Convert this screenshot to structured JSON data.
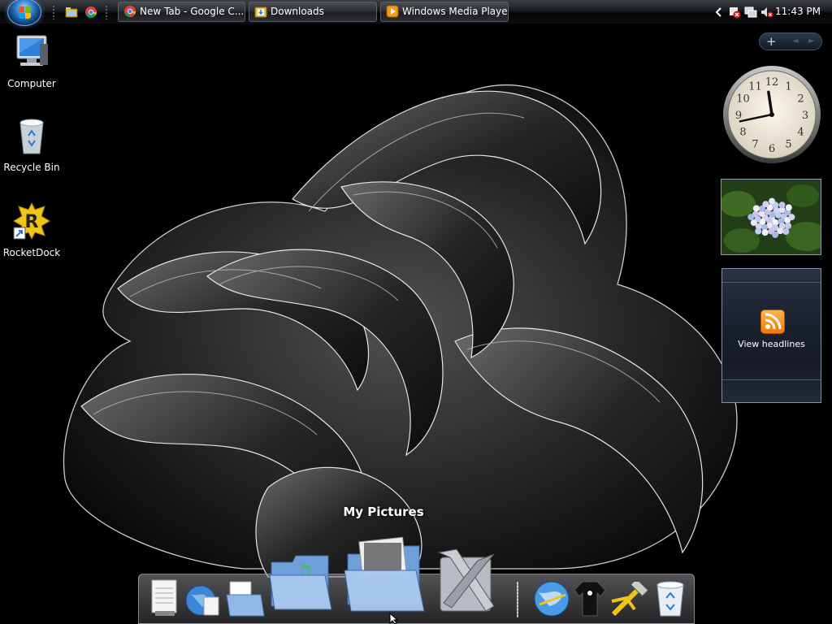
{
  "taskbar": {
    "start_button": "start-orb",
    "quick_launch": [
      "explorer-folder-icon",
      "chrome-icon"
    ],
    "windows": [
      {
        "label": "New Tab - Google C...",
        "icon": "chrome-icon"
      },
      {
        "label": "Downloads",
        "icon": "folder-icon"
      },
      {
        "label": "Windows Media Player",
        "icon": "media-player-icon"
      }
    ],
    "tray_icons": [
      "expand-tray-arrow-icon",
      "security-alert-icon",
      "network-icon",
      "volume-muted-icon"
    ],
    "clock": "11:43 PM"
  },
  "desktop_icons": [
    {
      "label": "Computer",
      "icon": "computer-icon"
    },
    {
      "label": "Recycle Bin",
      "icon": "recycle-bin-icon"
    },
    {
      "label": "RocketDock",
      "icon": "rocketdock-icon"
    }
  ],
  "gadgets": {
    "controls": {
      "add": "+",
      "prev": "◄",
      "next": "►"
    },
    "clock": {
      "hours": 11,
      "minutes": 43,
      "numerals": [
        "12",
        "1",
        "2",
        "3",
        "4",
        "5",
        "6",
        "7",
        "8",
        "9",
        "10",
        "11"
      ]
    },
    "slideshow": {
      "icon": "hydrangea-photo"
    },
    "feed_headlines": {
      "label": "View headlines",
      "icon": "rss-icon"
    }
  },
  "dock": {
    "hover_label": "My Pictures",
    "items": [
      "notepad-icon",
      "web-document-icon",
      "documents-folder-icon",
      "music-folder-icon",
      "pictures-folder-icon",
      "tools-icon",
      "globe-icon",
      "tshirt-icon",
      "hammer-icon",
      "recycle-bin-icon"
    ]
  },
  "colors": {
    "taskbar": "#1b1d20",
    "accent_blue": "#2a78c8",
    "rss_orange": "#f07800",
    "wallpaper": "#000000"
  }
}
